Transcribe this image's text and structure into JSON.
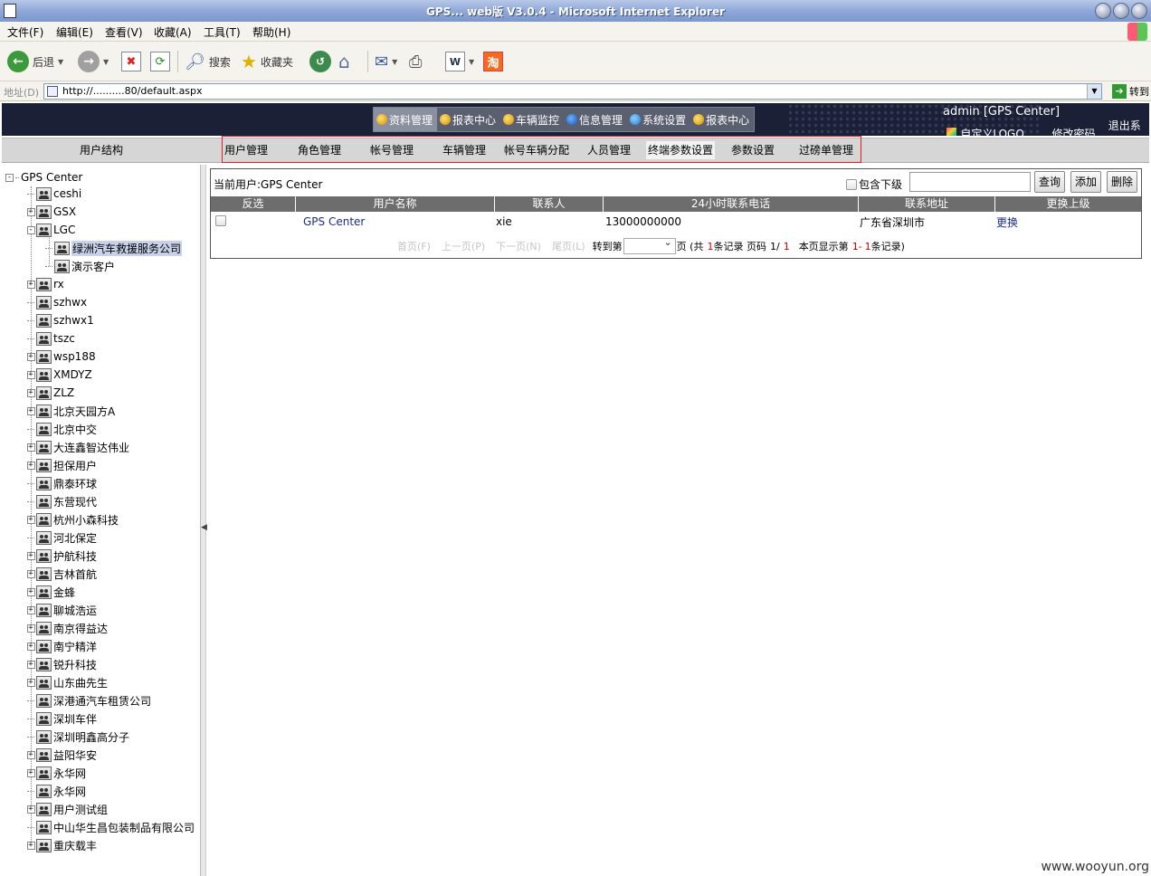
{
  "window": {
    "title": "GPS... web版 V3.0.4 - Microsoft Internet Explorer"
  },
  "menubar": [
    "文件(F)",
    "编辑(E)",
    "查看(V)",
    "收藏(A)",
    "工具(T)",
    "帮助(H)"
  ],
  "toolbar": {
    "back": "后退",
    "search": "搜索",
    "favorites": "收藏夹"
  },
  "address": {
    "label": "地址(D)",
    "url": "http://..........80/default.aspx",
    "go": "转到"
  },
  "header": {
    "nav": [
      "资料管理",
      "报表中心",
      "车辆监控",
      "信息管理",
      "系统设置",
      "报表中心"
    ],
    "active_nav": 0,
    "user": "admin [GPS Center]",
    "links": [
      "自定义LOGO",
      "修改密码",
      "退出系统"
    ]
  },
  "subnav": {
    "left_title": "用户结构",
    "tabs": [
      "用户管理",
      "角色管理",
      "帐号管理",
      "车辆管理",
      "帐号车辆分配",
      "人员管理",
      "终端参数设置",
      "参数设置",
      "过磅单管理"
    ],
    "active_tab": 6
  },
  "tree": {
    "root": "GPS Center",
    "nodes": [
      {
        "label": "ceshi",
        "expandable": false,
        "level": 1
      },
      {
        "label": "GSX",
        "expandable": true,
        "level": 1
      },
      {
        "label": "LGC",
        "expandable": true,
        "expanded": true,
        "level": 1
      },
      {
        "label": "绿洲汽车救援服务公司",
        "expandable": false,
        "level": 2,
        "selected": true
      },
      {
        "label": "演示客户",
        "expandable": false,
        "level": 2
      },
      {
        "label": "rx",
        "expandable": true,
        "level": 1
      },
      {
        "label": "szhwx",
        "expandable": false,
        "level": 1
      },
      {
        "label": "szhwx1",
        "expandable": false,
        "level": 1
      },
      {
        "label": "tszc",
        "expandable": false,
        "level": 1
      },
      {
        "label": "wsp188",
        "expandable": true,
        "level": 1
      },
      {
        "label": "XMDYZ",
        "expandable": true,
        "level": 1
      },
      {
        "label": "ZLZ",
        "expandable": true,
        "level": 1
      },
      {
        "label": "北京天园方A",
        "expandable": true,
        "level": 1
      },
      {
        "label": "北京中交",
        "expandable": false,
        "level": 1
      },
      {
        "label": "大连鑫智达伟业",
        "expandable": true,
        "level": 1
      },
      {
        "label": "担保用户",
        "expandable": true,
        "level": 1
      },
      {
        "label": "鼎泰环球",
        "expandable": false,
        "level": 1
      },
      {
        "label": "东营现代",
        "expandable": false,
        "level": 1
      },
      {
        "label": "杭州小森科技",
        "expandable": true,
        "level": 1
      },
      {
        "label": "河北保定",
        "expandable": false,
        "level": 1
      },
      {
        "label": "护航科技",
        "expandable": true,
        "level": 1
      },
      {
        "label": "吉林首航",
        "expandable": true,
        "level": 1
      },
      {
        "label": "金蜂",
        "expandable": true,
        "level": 1
      },
      {
        "label": "聊城浩运",
        "expandable": true,
        "level": 1
      },
      {
        "label": "南京得益达",
        "expandable": true,
        "level": 1
      },
      {
        "label": "南宁精洋",
        "expandable": true,
        "level": 1
      },
      {
        "label": "锐升科技",
        "expandable": true,
        "level": 1
      },
      {
        "label": "山东曲先生",
        "expandable": true,
        "level": 1
      },
      {
        "label": "深港通汽车租赁公司",
        "expandable": false,
        "level": 1
      },
      {
        "label": "深圳车伴",
        "expandable": false,
        "level": 1
      },
      {
        "label": "深圳明鑫高分子",
        "expandable": false,
        "level": 1
      },
      {
        "label": "益阳华安",
        "expandable": true,
        "level": 1
      },
      {
        "label": "永华网",
        "expandable": true,
        "level": 1
      },
      {
        "label": "永华网",
        "expandable": false,
        "level": 1
      },
      {
        "label": "用户测试组",
        "expandable": true,
        "level": 1
      },
      {
        "label": "中山华生昌包装制品有限公司",
        "expandable": false,
        "level": 1
      },
      {
        "label": "重庆载丰",
        "expandable": true,
        "level": 1
      }
    ]
  },
  "panel": {
    "current_user_label": "当前用户:GPS Center",
    "include_sub_label": "包含下级",
    "search_value": "",
    "buttons": {
      "query": "查询",
      "add": "添加",
      "delete": "删除"
    },
    "columns": [
      "反选",
      "用户名称",
      "联系人",
      "24小时联系电话",
      "联系地址",
      "更换上级"
    ],
    "rows": [
      {
        "name": "GPS Center",
        "contact": "xie",
        "phone": "13000000000",
        "address": "广东省深圳市",
        "action": "更换"
      }
    ],
    "pager": {
      "first": "首页(F)",
      "prev": "上一页(P)",
      "next": "下一页(N)",
      "last": "尾页(L)",
      "goto_label": "转到第",
      "page_suffix": "页 (共",
      "total": "1",
      "records_label": "条记录 页码",
      "current": "1/",
      "pages": "1",
      "show_label": "本页显示第",
      "range_start": "1-",
      "range_end": "1",
      "range_suffix": "条记录)"
    }
  },
  "watermark": "www.wooyun.org"
}
